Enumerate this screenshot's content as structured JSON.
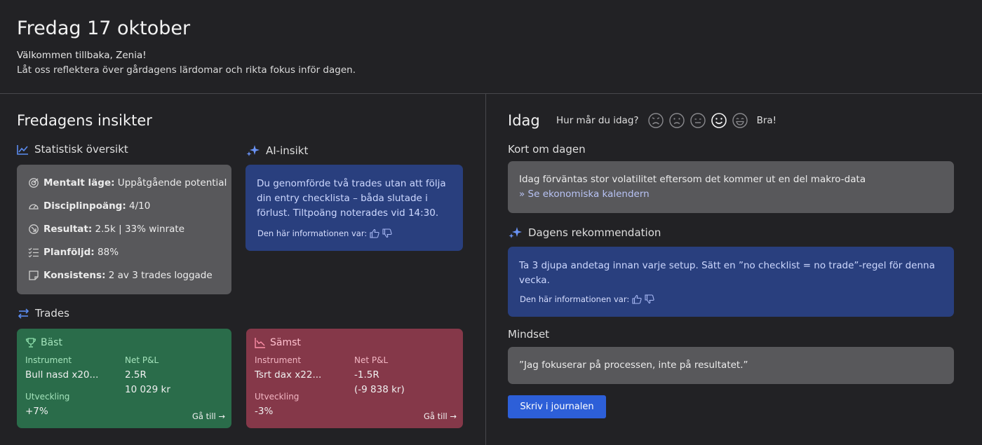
{
  "header": {
    "title": "Fredag 17 oktober",
    "welcome": "Välkommen tillbaka, Zenia!",
    "subtitle": "Låt oss reflektera över gårdagens lärdomar och rikta fokus inför dagen."
  },
  "insights": {
    "title": "Fredagens insikter",
    "stats": {
      "title": "Statistisk översikt",
      "rows": [
        {
          "label": "Mentalt läge:",
          "value": " Uppåtgående potential",
          "icon": "target-icon"
        },
        {
          "label": "Disciplinpoäng:",
          "value": " 4/10",
          "icon": "gauge-icon"
        },
        {
          "label": "Resultat:",
          "value": " 2.5k | 33% winrate",
          "icon": "arrow-down-right-icon"
        },
        {
          "label": "Planföljd:",
          "value": " 88%",
          "icon": "checklist-icon"
        },
        {
          "label": "Konsistens:",
          "value": " 2 av 3 trades loggade",
          "icon": "note-icon"
        }
      ]
    },
    "ai": {
      "title": "AI-insikt",
      "text": "Du genomförde två trades utan att följa din entry checklista – båda slutade i förlust. Tiltpoäng noterades vid 14:30.",
      "feedback": "Den här informationen var:"
    }
  },
  "trades": {
    "title": "Trades",
    "best": {
      "title": "Bäst",
      "instrument_label": "Instrument",
      "instrument": "Bull nasd x20...",
      "pnl_label": "Net P&L",
      "pnl_r": "2.5R",
      "pnl_kr": "10 029 kr",
      "dev_label": "Utveckling",
      "dev": "+7%",
      "goto": "Gå till →"
    },
    "worst": {
      "title": "Sämst",
      "instrument_label": "Instrument",
      "instrument": "Tsrt dax x22...",
      "pnl_label": "Net P&L",
      "pnl_r": "-1.5R",
      "pnl_kr": "(-9 838 kr)",
      "dev_label": "Utveckling",
      "dev": "-3%",
      "goto": "Gå till →"
    }
  },
  "today": {
    "title": "Idag",
    "mood_question": "Hur mår du idag?",
    "mood_selected": "Bra!",
    "summary_title": "Kort om dagen",
    "summary_text": "Idag förväntas stor volatilitet eftersom det kommer ut en del makro-data",
    "summary_link": "» Se ekonomiska kalendern",
    "rec_title": "Dagens rekommendation",
    "rec_text": "Ta 3 djupa andetag innan varje setup. Sätt en ”no checklist = no trade”-regel för denna vecka.",
    "rec_feedback": "Den här informationen var:",
    "mindset_title": "Mindset",
    "mindset_text": "”Jag fokuserar på processen, inte på resultatet.”",
    "journal_button": "Skriv i journalen"
  },
  "colors": {
    "accent": "#2d5fd8",
    "ai_card": "#293f7e",
    "best_card": "#2a6c4a",
    "worst_card": "#853849"
  }
}
